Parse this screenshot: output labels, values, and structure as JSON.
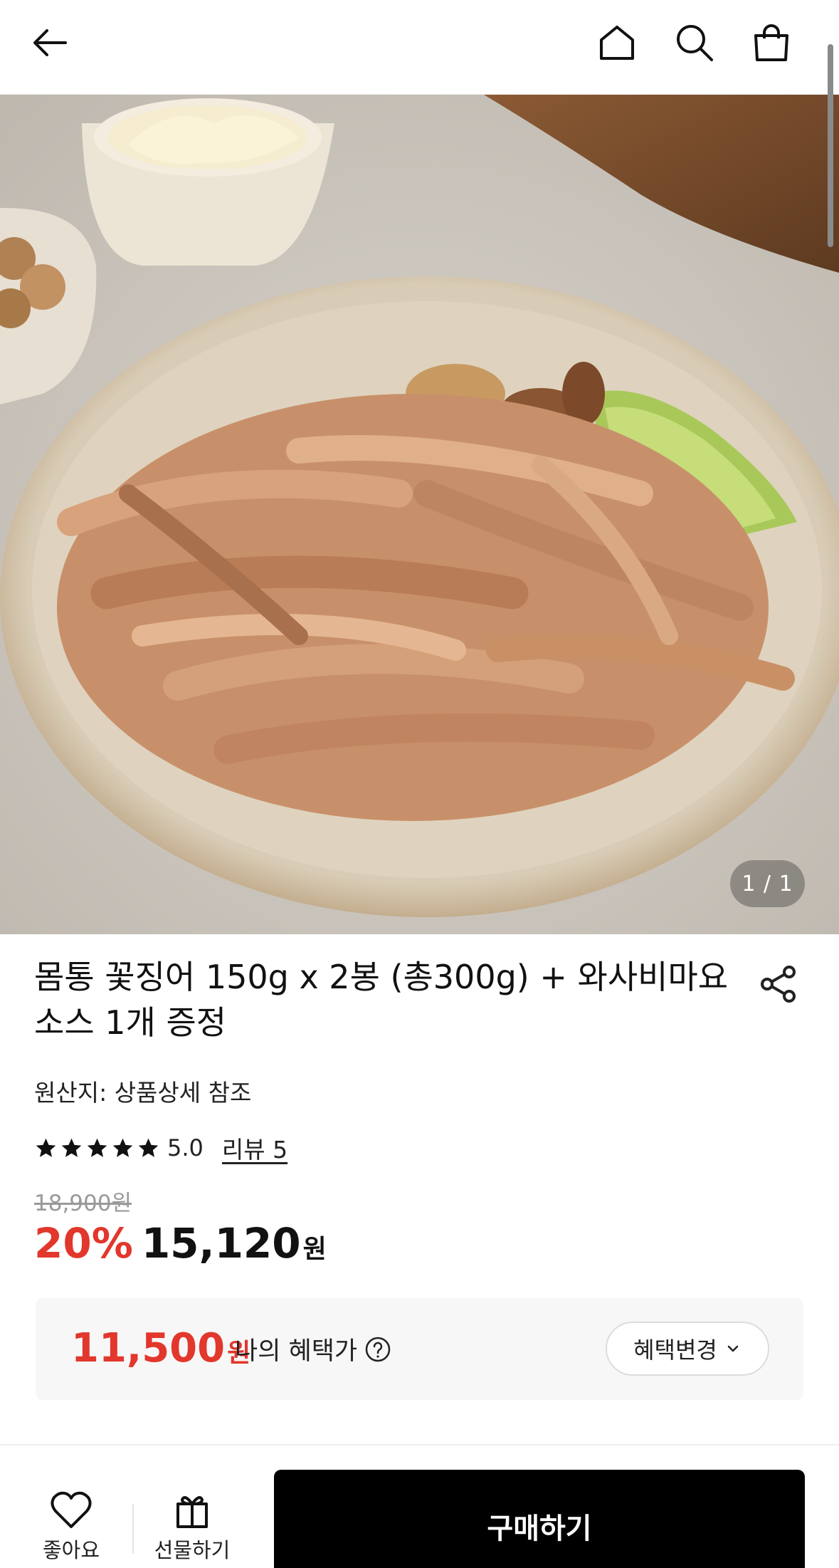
{
  "header": {
    "back_icon": "arrow-left-icon",
    "home_icon": "home-icon",
    "search_icon": "search-icon",
    "cart_icon": "shopping-bag-icon"
  },
  "gallery": {
    "counter": "1 / 1",
    "current_index": 1,
    "total": 1
  },
  "product": {
    "title_line1": "몸통 꽃징어 150g x 2봉 (총300g) + 와사비마요",
    "title_line2": "소스 1개 증정",
    "share_icon": "share-icon",
    "origin": "원산지: 상품상세 참조",
    "rating_score": "5.0",
    "rating_stars": 5,
    "review_link": "리뷰 5",
    "original_price": "18,900원",
    "discount": "20%",
    "sale_price": "15,120",
    "currency": "원"
  },
  "benefit": {
    "price": "11,500",
    "currency": "원",
    "label": "나의 혜택가",
    "help_icon": "question-circle-icon",
    "change_button": "혜택변경",
    "change_icon": "chevron-down-icon"
  },
  "bottom_bar": {
    "like_label": "좋아요",
    "gift_label": "선물하기",
    "buy_label": "구매하기"
  },
  "colors": {
    "accent_red": "#e2372c",
    "buy_button": "#000000",
    "benefit_bg": "#f7f7f7"
  }
}
